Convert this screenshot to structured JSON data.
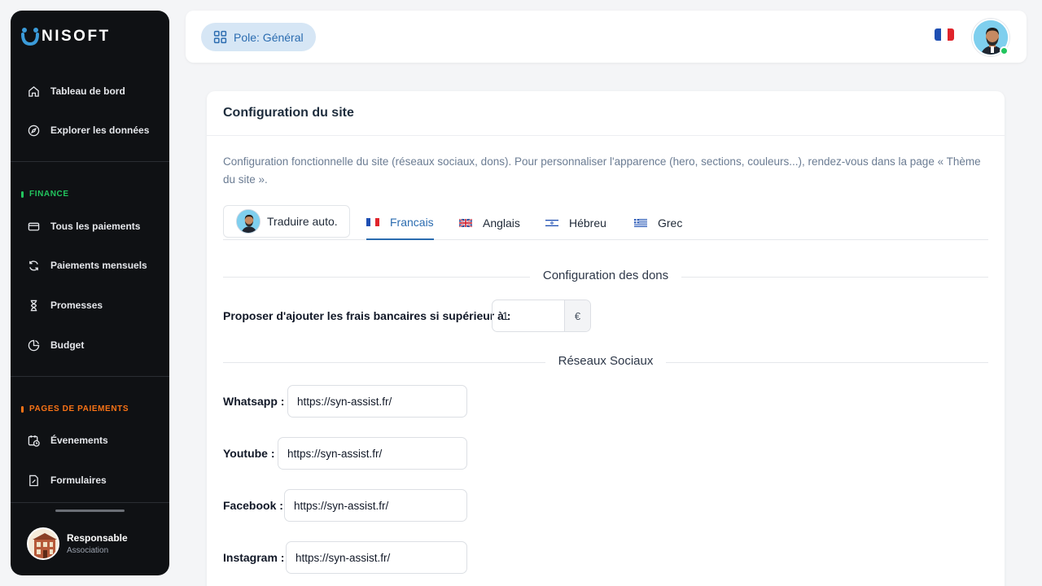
{
  "brand": {
    "name": "NISOFT",
    "logo_letter": "U"
  },
  "sidebar": {
    "items_top": [
      {
        "label": "Tableau de bord",
        "icon": "home-icon"
      },
      {
        "label": "Explorer les données",
        "icon": "compass-icon"
      }
    ],
    "finance": {
      "title": "FINANCE",
      "color": "#22c55e",
      "items": [
        {
          "label": "Tous les paiements",
          "icon": "credit-card-icon"
        },
        {
          "label": "Paiements mensuels",
          "icon": "refresh-icon"
        },
        {
          "label": "Promesses",
          "icon": "hourglass-icon"
        },
        {
          "label": "Budget",
          "icon": "pie-chart-icon"
        }
      ]
    },
    "pages": {
      "title": "PAGES DE PAIEMENTS",
      "color": "#f97316",
      "items": [
        {
          "label": "Évenements",
          "icon": "calendar-clock-icon"
        },
        {
          "label": "Formulaires",
          "icon": "form-file-icon"
        }
      ]
    },
    "user": {
      "name": "Responsable",
      "role": "Association"
    }
  },
  "topbar": {
    "pole_label": "Pole: Général"
  },
  "card": {
    "title": "Configuration du site",
    "description": "Configuration fonctionnelle du site (réseaux sociaux, dons). Pour personnaliser l'apparence (hero, sections, couleurs...), rendez-vous dans la page « Thème du site ».",
    "tabs": {
      "translate_label": "Traduire auto.",
      "languages": [
        {
          "label": "Francais",
          "active": true
        },
        {
          "label": "Anglais",
          "active": false
        },
        {
          "label": "Hébreu",
          "active": false
        },
        {
          "label": "Grec",
          "active": false
        }
      ]
    },
    "donations": {
      "section_title": "Configuration des dons",
      "fee_label": "Proposer d'ajouter les frais bancaires si supérieur à :",
      "fee_value": "1",
      "currency": "€"
    },
    "social": {
      "section_title": "Réseaux Sociaux",
      "fields": [
        {
          "label": "Whatsapp :",
          "value": "https://syn-assist.fr/"
        },
        {
          "label": "Youtube :",
          "value": "https://syn-assist.fr/"
        },
        {
          "label": "Facebook :",
          "value": "https://syn-assist.fr/"
        },
        {
          "label": "Instagram :",
          "value": "https://syn-assist.fr/"
        }
      ]
    }
  }
}
